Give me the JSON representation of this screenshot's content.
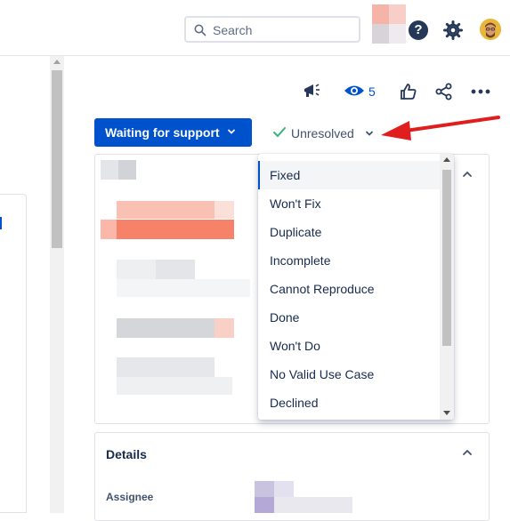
{
  "header": {
    "search_placeholder": "Search",
    "help_icon": "?"
  },
  "actions": {
    "feedback_icon": "megaphone-icon",
    "watch_count": "5",
    "like_icon": "thumbs-up-icon",
    "share_icon": "share-icon",
    "more_icon": "more-icon"
  },
  "status": {
    "label": "Waiting for support",
    "resolution": "Unresolved"
  },
  "resolution_menu": {
    "items": [
      "Fixed",
      "Won't Fix",
      "Duplicate",
      "Incomplete",
      "Cannot Reproduce",
      "Done",
      "Won't Do",
      "No Valid Use Case",
      "Declined"
    ],
    "selected": "Fixed"
  },
  "details": {
    "title": "Details",
    "assignee_label": "Assignee"
  },
  "colors": {
    "primary": "#0052cc",
    "annotation_arrow": "#e01e1e",
    "success": "#36b37e"
  }
}
